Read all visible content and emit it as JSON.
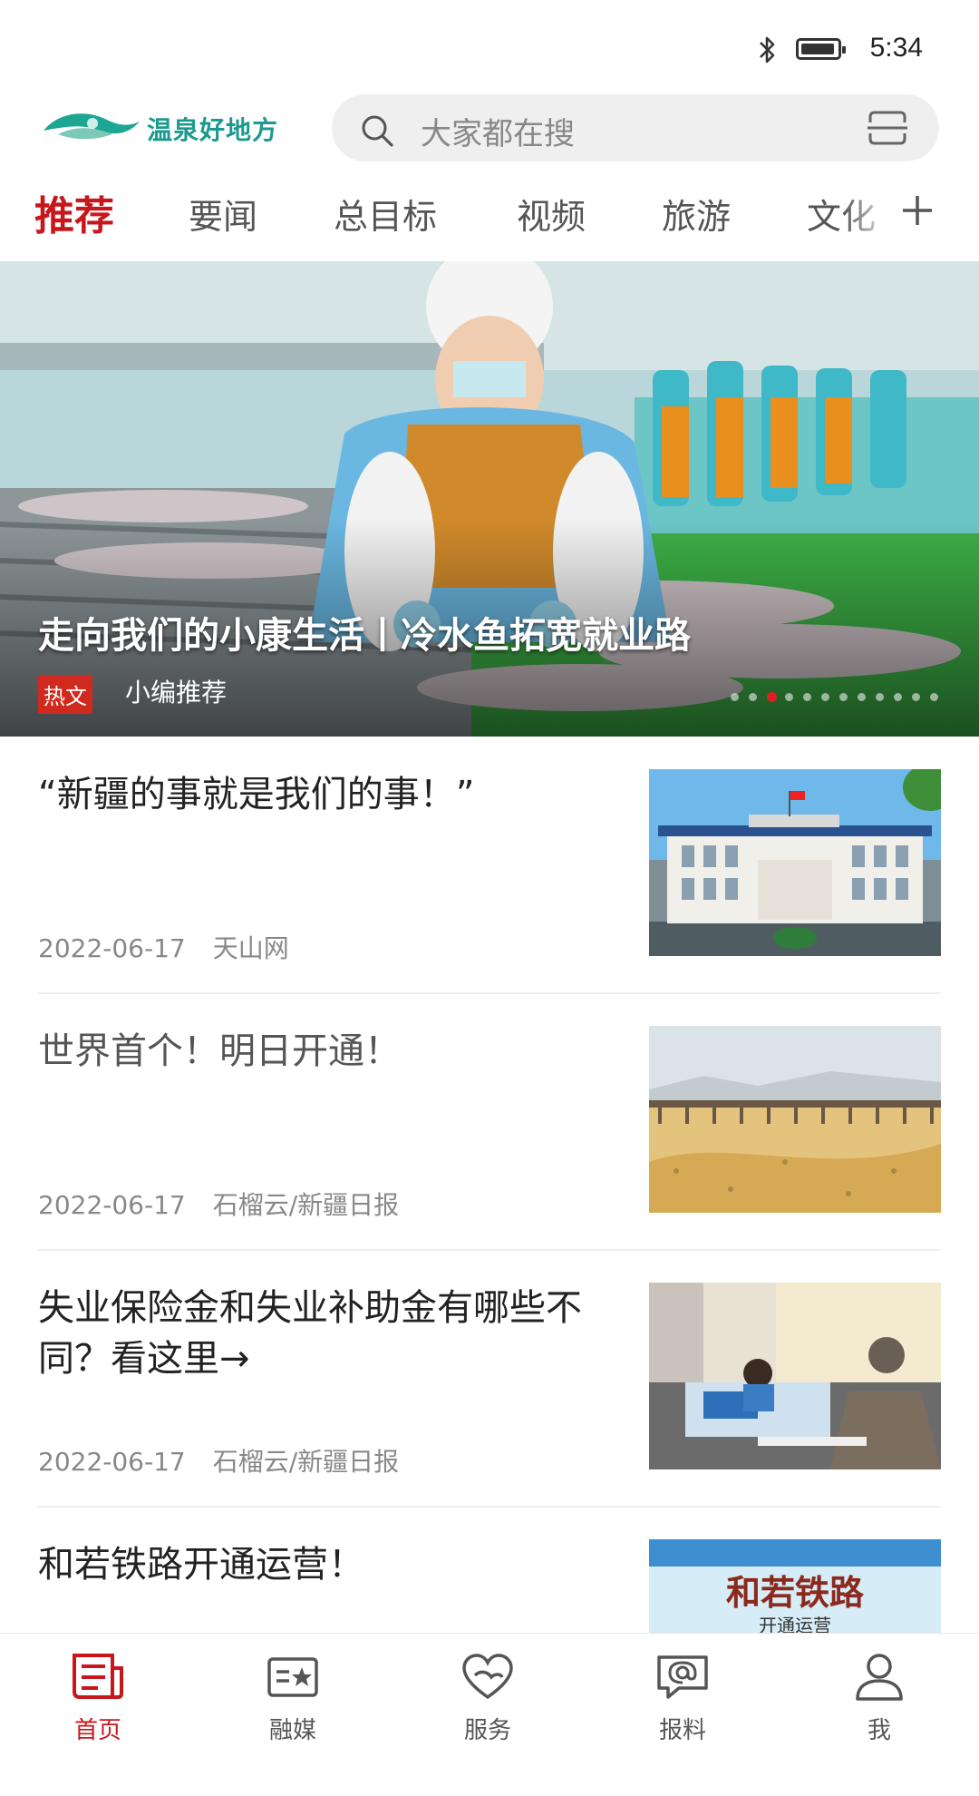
{
  "status_bar": {
    "time": "5:34",
    "icons": [
      "bluetooth-icon",
      "battery-icon"
    ]
  },
  "header": {
    "logo_text": "温泉好地方",
    "search_placeholder": "大家都在搜"
  },
  "tabs": [
    {
      "label": "推荐",
      "active": true
    },
    {
      "label": "要闻"
    },
    {
      "label": "总目标"
    },
    {
      "label": "视频"
    },
    {
      "label": "旅游"
    },
    {
      "label": "文化"
    }
  ],
  "banner": {
    "title": "走向我们的小康生活丨冷水鱼拓宽就业路",
    "badge": "热文",
    "source": "小编推荐",
    "slide_count": 12,
    "active_slide": 2
  },
  "news": [
    {
      "title": "“新疆的事就是我们的事！”",
      "date": "2022-06-17",
      "source": "天山网"
    },
    {
      "title": "世界首个！明日开通！",
      "date": "2022-06-17",
      "source": "石榴云/新疆日报"
    },
    {
      "title": "失业保险金和失业补助金有哪些不同？看这里→",
      "date": "2022-06-17",
      "source": "石榴云/新疆日报"
    },
    {
      "title": "和若铁路开通运营！",
      "thumb_text": "和若铁路",
      "thumb_subtext": "开通运营"
    }
  ],
  "bottom_nav": [
    {
      "label": "首页",
      "icon": "newspaper-icon",
      "active": true
    },
    {
      "label": "融媒",
      "icon": "media-card-icon"
    },
    {
      "label": "服务",
      "icon": "heart-service-icon"
    },
    {
      "label": "报料",
      "icon": "report-message-icon"
    },
    {
      "label": "我",
      "icon": "user-icon"
    }
  ],
  "colors": {
    "accent": "#c8161d",
    "logo": "#1a9a8e",
    "text_primary": "#222222",
    "text_meta": "#888888"
  }
}
